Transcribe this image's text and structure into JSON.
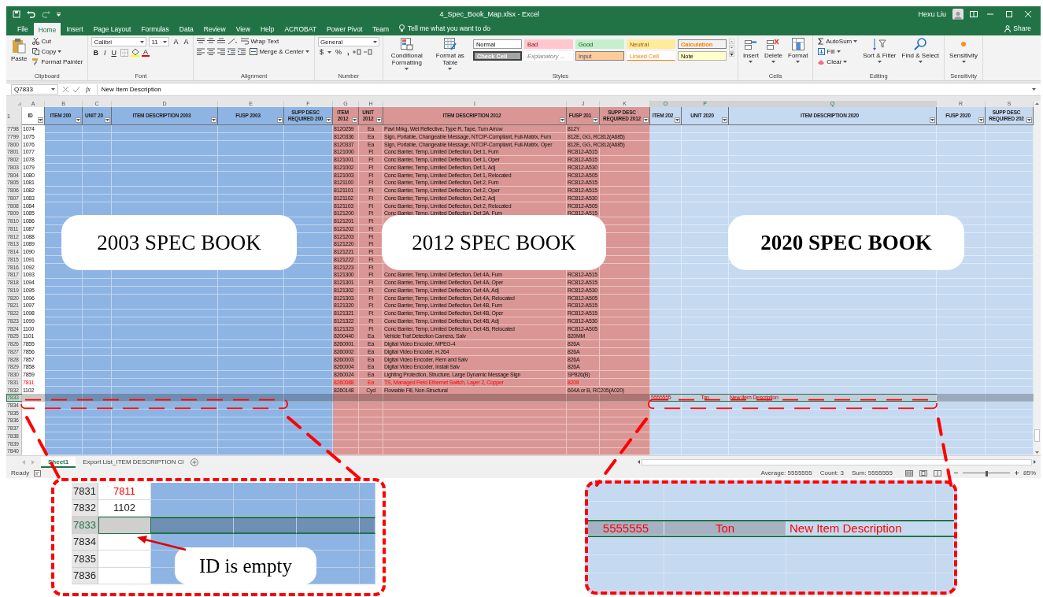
{
  "window": {
    "title": "4_Spec_Book_Map.xlsx  -  Excel",
    "user": "Hexu Liu"
  },
  "ribbon_tabs": [
    {
      "label": "File",
      "selected": false
    },
    {
      "label": "Home",
      "selected": true
    },
    {
      "label": "Insert",
      "selected": false
    },
    {
      "label": "Page Layout",
      "selected": false
    },
    {
      "label": "Formulas",
      "selected": false
    },
    {
      "label": "Data",
      "selected": false
    },
    {
      "label": "Review",
      "selected": false
    },
    {
      "label": "View",
      "selected": false
    },
    {
      "label": "Help",
      "selected": false
    },
    {
      "label": "ACROBAT",
      "selected": false
    },
    {
      "label": "Power Pivot",
      "selected": false
    },
    {
      "label": "Team",
      "selected": false
    }
  ],
  "tell_me": {
    "placeholder": "Tell me what you want to do"
  },
  "share": "Share",
  "ribbon_groups": [
    {
      "kind": "clipboard",
      "name": "Clipboard",
      "paste": "Paste",
      "cut": "Cut",
      "copy": "Copy",
      "painter": "Format Painter"
    },
    {
      "kind": "font",
      "name": "Font",
      "face": "Calibri",
      "size": "11",
      "grow": "A",
      "shrink": "A",
      "bold": "B",
      "italic": "I",
      "underline": "U",
      "font_color": "A"
    },
    {
      "kind": "alignment",
      "name": "Alignment",
      "wrap": "Wrap Text",
      "merge": "Merge & Center"
    },
    {
      "kind": "number",
      "name": "Number",
      "format": "General",
      "currency": "$",
      "percent": "%",
      "comma": ","
    },
    {
      "kind": "styles",
      "name": "Styles",
      "conditional": "Conditional Formatting",
      "table": "Format as Table",
      "cells": [
        {
          "label": "Normal",
          "kind": "normal"
        },
        {
          "label": "Bad",
          "kind": "bad"
        },
        {
          "label": "Good",
          "kind": "good"
        },
        {
          "label": "Neutral",
          "kind": "neutral"
        },
        {
          "label": "Calculation",
          "kind": "calculation"
        },
        {
          "label": "Check Cell",
          "kind": "check"
        },
        {
          "label": "Explanatory ...",
          "kind": "explanatory"
        },
        {
          "label": "Input",
          "kind": "input"
        },
        {
          "label": "Linked Cell",
          "kind": "linked"
        },
        {
          "label": "Note",
          "kind": "note"
        }
      ]
    },
    {
      "kind": "cells",
      "name": "Cells",
      "insert": "Insert",
      "delete": "Delete",
      "format": "Format"
    },
    {
      "kind": "editing",
      "name": "Editing",
      "autosum": "AutoSum",
      "fill": "Fill",
      "clear": "Clear",
      "sort": "Sort & Filter",
      "find": "Find & Select"
    },
    {
      "kind": "sensitivity",
      "name": "Sensitivity",
      "label": "Sensitivity"
    }
  ],
  "formula_bar": {
    "name_box": "Q7833",
    "fx": "fx",
    "value": "New Item Description"
  },
  "sheet": {
    "corner_row": "1",
    "columns": [
      {
        "letter": "A",
        "header": "ID",
        "color": "#ffffff",
        "selected": false
      },
      {
        "letter": "B",
        "header": "ITEM 200",
        "color": "#8eb4e3",
        "selected": false
      },
      {
        "letter": "C",
        "header": "UNIT 20",
        "color": "#8eb4e3",
        "selected": false
      },
      {
        "letter": "D",
        "header": "ITEM DESCRIPTION 2003",
        "color": "#8eb4e3",
        "selected": false
      },
      {
        "letter": "E",
        "header": "FUSP 2003",
        "color": "#8eb4e3",
        "selected": false
      },
      {
        "letter": "F",
        "header": "SUPP DESC REQUIRED 200",
        "color": "#8eb4e3",
        "selected": false
      },
      {
        "letter": "G",
        "header": "ITEM 2012",
        "color": "#da9694",
        "selected": false
      },
      {
        "letter": "H",
        "header": "UNIT 2012",
        "color": "#da9694",
        "selected": false
      },
      {
        "letter": "I",
        "header": "ITEM DESCRIPTION 2012",
        "color": "#da9694",
        "selected": false
      },
      {
        "letter": "J",
        "header": "FUSP 201",
        "color": "#da9694",
        "selected": false
      },
      {
        "letter": "K",
        "header": "SUPP DESC REQUIRED 2012",
        "color": "#da9694",
        "selected": false
      },
      {
        "letter": "O",
        "header": "ITEM 202",
        "color": "#c5d9f1",
        "selected": true
      },
      {
        "letter": "P",
        "header": "UNIT 2020",
        "color": "#c5d9f1",
        "selected": true
      },
      {
        "letter": "Q",
        "header": "ITEM DESCRIPTION 2020",
        "color": "#c5d9f1",
        "selected": true
      },
      {
        "letter": "R",
        "header": "FUSP 2020",
        "color": "#c5d9f1",
        "selected": false
      },
      {
        "letter": "S",
        "header": "SUPP DESC REQUIRED 202",
        "color": "#c5d9f1",
        "selected": false
      }
    ],
    "rows": [
      {
        "n": "7798",
        "selected": false,
        "flagged": false,
        "values": {
          "A": "1074",
          "G": "8120259",
          "H": "Ea",
          "I": "Pavt Mrkg, Wet Reflective, Type R, Tape, Turn Arrow",
          "J": "812Y"
        }
      },
      {
        "n": "7799",
        "selected": false,
        "flagged": false,
        "values": {
          "A": "1075",
          "G": "8120336",
          "H": "Ea",
          "I": "Sign, Portable, Changeable Message, NTCIP-Compliant, Full-Matrix, Furn",
          "J": "812E, GG, RC812(A685)"
        }
      },
      {
        "n": "7800",
        "selected": false,
        "flagged": false,
        "values": {
          "A": "1076",
          "G": "8120337",
          "H": "Ea",
          "I": "Sign, Portable, Changeable Message, NTCIP-Compliant, Full-Matrix, Oper",
          "J": "812E, GG, RC812(A685)"
        }
      },
      {
        "n": "7801",
        "selected": false,
        "flagged": false,
        "values": {
          "A": "1077",
          "G": "8121000",
          "H": "Ft",
          "I": "Conc Barrier, Temp, Limited Deflection, Det 1, Furn",
          "J": "RC812-A515"
        }
      },
      {
        "n": "7802",
        "selected": false,
        "flagged": false,
        "values": {
          "A": "1078",
          "G": "8121001",
          "H": "Ft",
          "I": "Conc Barrier, Temp, Limited Deflection, Det 1, Oper",
          "J": "RC812-A515"
        }
      },
      {
        "n": "7803",
        "selected": false,
        "flagged": false,
        "values": {
          "A": "1079",
          "G": "8121002",
          "H": "Ft",
          "I": "Conc Barrier, Temp, Limited Deflection, Det 1, Adj",
          "J": "RC812-A530"
        }
      },
      {
        "n": "7804",
        "selected": false,
        "flagged": false,
        "values": {
          "A": "1080",
          "G": "8121003",
          "H": "Ft",
          "I": "Conc Barrier, Temp, Limited Deflection, Det 1, Relocated",
          "J": "RC812-A505"
        }
      },
      {
        "n": "7805",
        "selected": false,
        "flagged": false,
        "values": {
          "A": "1081",
          "G": "8121100",
          "H": "Ft",
          "I": "Conc Barrier, Temp, Limited Deflection, Det 2, Furn",
          "J": "RC812-A515"
        }
      },
      {
        "n": "7806",
        "selected": false,
        "flagged": false,
        "values": {
          "A": "1082",
          "G": "8121101",
          "H": "Ft",
          "I": "Conc Barrier, Temp, Limited Deflection, Det 2, Oper",
          "J": "RC812-A515"
        }
      },
      {
        "n": "7807",
        "selected": false,
        "flagged": false,
        "values": {
          "A": "1083",
          "G": "8121102",
          "H": "Ft",
          "I": "Conc Barrier, Temp, Limited Deflection, Det 2, Adj",
          "J": "RC812-A530"
        }
      },
      {
        "n": "7808",
        "selected": false,
        "flagged": false,
        "values": {
          "A": "1084",
          "G": "8121103",
          "H": "Ft",
          "I": "Conc Barrier, Temp, Limited Deflection, Det 2, Relocated",
          "J": "RC812-A505"
        }
      },
      {
        "n": "7809",
        "selected": false,
        "flagged": false,
        "values": {
          "A": "1085",
          "G": "8121200",
          "H": "Ft",
          "I": "Conc Barrier, Temp, Limited Deflection, Det 3A, Furn",
          "J": "RC812-A515"
        }
      },
      {
        "n": "7810",
        "selected": false,
        "flagged": false,
        "values": {
          "A": "1086",
          "G": "8121201",
          "H": "Ft"
        }
      },
      {
        "n": "7811",
        "selected": false,
        "flagged": false,
        "values": {
          "A": "1087",
          "G": "8121202",
          "H": "Ft"
        }
      },
      {
        "n": "7812",
        "selected": false,
        "flagged": false,
        "values": {
          "A": "1088",
          "G": "8121203",
          "H": "Ft"
        }
      },
      {
        "n": "7813",
        "selected": false,
        "flagged": false,
        "values": {
          "A": "1089",
          "G": "8121220",
          "H": "Ft"
        }
      },
      {
        "n": "7814",
        "selected": false,
        "flagged": false,
        "values": {
          "A": "1090",
          "G": "8121221",
          "H": "Ft"
        }
      },
      {
        "n": "7815",
        "selected": false,
        "flagged": false,
        "values": {
          "A": "1091",
          "G": "8121222",
          "H": "Ft"
        }
      },
      {
        "n": "7816",
        "selected": false,
        "flagged": false,
        "values": {
          "A": "1092",
          "G": "8121223",
          "H": "Ft"
        }
      },
      {
        "n": "7817",
        "selected": false,
        "flagged": false,
        "values": {
          "A": "1093",
          "G": "8121300",
          "H": "Ft",
          "I": "Conc Barrier, Temp, Limited Deflection, Det 4A, Furn",
          "J": "RC812-A515"
        }
      },
      {
        "n": "7818",
        "selected": false,
        "flagged": false,
        "values": {
          "A": "1094",
          "G": "8121301",
          "H": "Ft",
          "I": "Conc Barrier, Temp, Limited Deflection, Det 4A, Oper",
          "J": "RC812-A515"
        }
      },
      {
        "n": "7819",
        "selected": false,
        "flagged": false,
        "values": {
          "A": "1095",
          "G": "8121302",
          "H": "Ft",
          "I": "Conc Barrier, Temp, Limited Deflection, Det 4A, Adj",
          "J": "RC812-A530"
        }
      },
      {
        "n": "7820",
        "selected": false,
        "flagged": false,
        "values": {
          "A": "1096",
          "G": "8121303",
          "H": "Ft",
          "I": "Conc Barrier, Temp, Limited Deflection, Det 4A, Relocated",
          "J": "RC812-A505"
        }
      },
      {
        "n": "7821",
        "selected": false,
        "flagged": false,
        "values": {
          "A": "1097",
          "G": "8121320",
          "H": "Ft",
          "I": "Conc Barrier, Temp, Limited Deflection, Det 4B, Furn",
          "J": "RC812-A515"
        }
      },
      {
        "n": "7822",
        "selected": false,
        "flagged": false,
        "values": {
          "A": "1098",
          "G": "8121321",
          "H": "Ft",
          "I": "Conc Barrier, Temp, Limited Deflection, Det 4B, Oper",
          "J": "RC812-A515"
        }
      },
      {
        "n": "7823",
        "selected": false,
        "flagged": false,
        "values": {
          "A": "1099",
          "G": "8121322",
          "H": "Ft",
          "I": "Conc Barrier, Temp, Limited Deflection, Det 4B, Adj",
          "J": "RC812-A530"
        }
      },
      {
        "n": "7824",
        "selected": false,
        "flagged": false,
        "values": {
          "A": "1100",
          "G": "8121323",
          "H": "Ft",
          "I": "Conc Barrier, Temp, Limited Deflection, Det 4B, Relocated",
          "J": "RC812-A505"
        }
      },
      {
        "n": "7825",
        "selected": false,
        "flagged": false,
        "values": {
          "A": "1101",
          "G": "8200440",
          "H": "Ea",
          "I": "Vehicle Traf Detection Camera, Salv",
          "J": "820MM"
        }
      },
      {
        "n": "7826",
        "selected": false,
        "flagged": false,
        "values": {
          "A": "7855",
          "G": "8260001",
          "H": "Ea",
          "I": "Digital Video Encoder, MPEG-4",
          "J": "826A"
        }
      },
      {
        "n": "7827",
        "selected": false,
        "flagged": false,
        "values": {
          "A": "7856",
          "G": "8260002",
          "H": "Ea",
          "I": "Digital Video Encoder, H.264",
          "J": "826A"
        }
      },
      {
        "n": "7828",
        "selected": false,
        "flagged": false,
        "values": {
          "A": "7857",
          "G": "8260003",
          "H": "Ea",
          "I": "Digital Video Encoder, Rem and Salv",
          "J": "826A"
        }
      },
      {
        "n": "7829",
        "selected": false,
        "flagged": false,
        "values": {
          "A": "7858",
          "G": "8260004",
          "H": "Ea",
          "I": "Digital Video Encoder, Install Salv",
          "J": "826A"
        }
      },
      {
        "n": "7830",
        "selected": false,
        "flagged": false,
        "values": {
          "A": "7859",
          "G": "8260024",
          "H": "Ea",
          "I": "Lighting Protection, Structure, Large Dynamic Message Sign",
          "J": "SP826(B)"
        }
      },
      {
        "n": "7831",
        "selected": false,
        "flagged": true,
        "values": {
          "A": "7811",
          "G": "8260088",
          "H": "Ea",
          "I": "TS, Managed Field Ethernet Switch, Layer 2, Copper",
          "J": "820II"
        }
      },
      {
        "n": "7832",
        "selected": false,
        "flagged": false,
        "values": {
          "A": "1102",
          "G": "8260148",
          "H": "Cyd",
          "I": "Flowable Fill, Non-Structural",
          "J": "604A or B, RC205(A020)"
        }
      },
      {
        "n": "7833",
        "selected": true,
        "flagged": true,
        "values": {
          "O": "5555555",
          "P": "Ton",
          "Q": "New Item Description"
        }
      },
      {
        "n": "7834",
        "selected": false,
        "values": {}
      },
      {
        "n": "7835",
        "selected": false,
        "values": {}
      },
      {
        "n": "7836",
        "selected": false,
        "values": {}
      },
      {
        "n": "7837",
        "selected": false,
        "values": {}
      },
      {
        "n": "7838",
        "selected": false,
        "values": {}
      },
      {
        "n": "7839",
        "selected": false,
        "values": {}
      },
      {
        "n": "7840",
        "selected": false,
        "values": {}
      }
    ]
  },
  "labels": [
    {
      "text": "2003 SPEC BOOK",
      "bold": false
    },
    {
      "text": "2012 SPEC BOOK",
      "bold": false
    },
    {
      "text": "2020 SPEC BOOK",
      "bold": true
    }
  ],
  "sheet_tabs": [
    {
      "label": "Sheet1",
      "selected": true
    },
    {
      "label": "Export List_ITEM DESCRIPTION Cl",
      "selected": false
    }
  ],
  "status_bar": {
    "mode": "Ready",
    "summary": [
      "Average: 5555555",
      "Count: 3",
      "Sum: 5555555"
    ],
    "zoom": "85%",
    "level": 0.5
  },
  "left_zoom": {
    "note": "ID is empty",
    "rows": [
      {
        "n": "7831",
        "id": "7811",
        "flagged": true,
        "selected": false
      },
      {
        "n": "7832",
        "id": "1102",
        "flagged": false,
        "selected": false
      },
      {
        "n": "7833",
        "flagged": false,
        "selected": true
      },
      {
        "n": "7834",
        "flagged": false,
        "selected": false
      },
      {
        "n": "7835",
        "flagged": false,
        "selected": false
      },
      {
        "n": "7836",
        "flagged": false,
        "selected": false
      }
    ]
  },
  "right_zoom": {
    "flagged": true,
    "values": [
      "5555555",
      "Ton",
      "New Item Description"
    ]
  }
}
